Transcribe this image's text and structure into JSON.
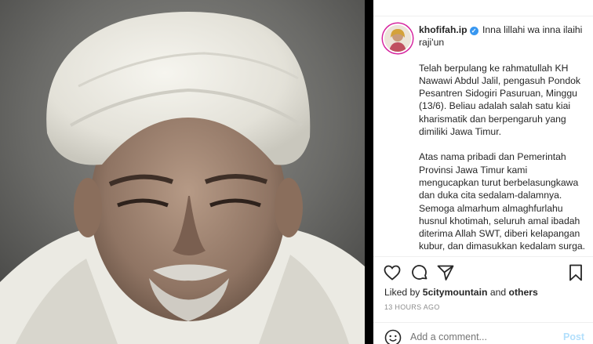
{
  "post": {
    "username": "khofifah.ip",
    "caption_title": "Inna lillahi wa inna ilaihi raji'un",
    "paragraphs": [
      "Telah berpulang ke rahmatullah KH Nawawi Abdul Jalil, pengasuh Pondok Pesantren Sidogiri Pasuruan, Minggu (13/6). Beliau adalah salah satu kiai kharismatik dan berpengaruh yang dimiliki Jawa Timur.",
      "Atas nama pribadi dan Pemerintah Provinsi Jawa Timur kami mengucapkan turut berbelasungkawa dan duka cita sedalam-dalamnya. Semoga almarhum almaghfurlahu husnul khotimah, seluruh amal ibadah diterima Allah SWT, diberi kelapangan kubur, dan dimasukkan kedalam surga. Begitu juga dengan keluarga dan santri yang ditinggalkan, semoga"
    ]
  },
  "likes": {
    "prefix": "Liked by",
    "user": "5citymountain",
    "conj": "and",
    "others": "others"
  },
  "timestamp": "13 HOURS AGO",
  "comment": {
    "placeholder": "Add a comment...",
    "post_label": "Post"
  },
  "icons": {
    "like": "heart-icon",
    "comment": "comment-icon",
    "share": "share-icon",
    "save": "bookmark-icon",
    "emoji": "emoji-icon",
    "verified": "verified-icon"
  },
  "colors": {
    "verified": "#3897f0",
    "post_button": "#b2dffc",
    "text": "#262626",
    "muted": "#8e8e8e"
  }
}
